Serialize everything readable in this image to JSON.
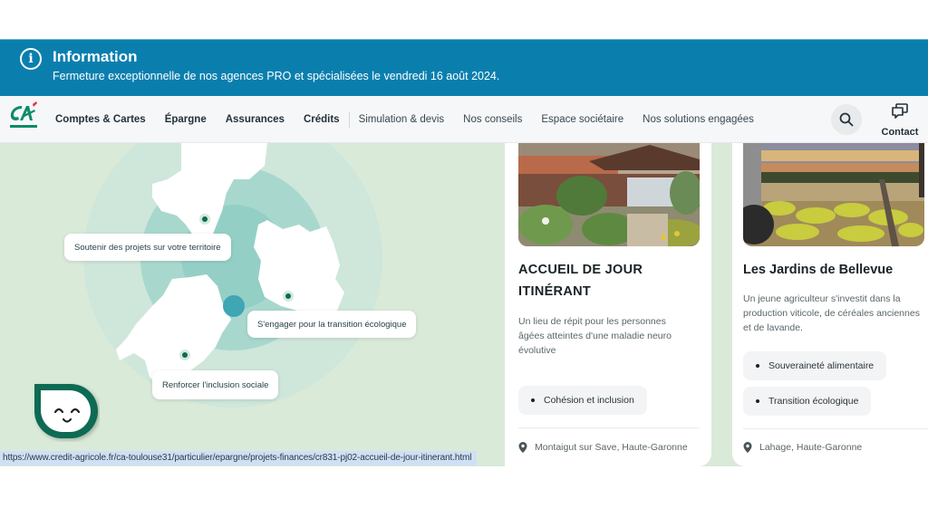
{
  "banner": {
    "icon": "info-circle-icon",
    "title": "Information",
    "message": "Fermeture exceptionnelle de nos agences PRO et spécialisées le vendredi 16 août 2024."
  },
  "nav": {
    "logo_alt": "Crédit Agricole",
    "primary_items": [
      {
        "label": "Comptes & Cartes"
      },
      {
        "label": "Épargne"
      },
      {
        "label": "Assurances"
      },
      {
        "label": "Crédits"
      }
    ],
    "secondary_items": [
      {
        "label": "Simulation & devis"
      },
      {
        "label": "Nos conseils"
      },
      {
        "label": "Espace sociétaire"
      },
      {
        "label": "Nos solutions engagées"
      }
    ],
    "search_icon": "search-icon",
    "contact_label": "Contact",
    "contact_icon": "chat-bubbles-icon"
  },
  "map": {
    "labels": [
      {
        "text": "Soutenir des projets sur votre territoire"
      },
      {
        "text": "S'engager pour la transition écologique"
      },
      {
        "text": "Renforcer l'inclusion sociale"
      }
    ]
  },
  "cards": [
    {
      "title": "ACCUEIL DE JOUR ITINÉRANT",
      "description": "Un lieu de répit pour les personnes âgées atteintes d'une maladie neuro évolutive",
      "tags": [
        "Cohésion et inclusion"
      ],
      "location": "Montaigut sur Save, Haute-Garonne"
    },
    {
      "title": "Les Jardins de Bellevue",
      "description": "Un jeune agriculteur s'investit dans la production viticole, de céréales anciennes et de lavande.",
      "tags": [
        "Souveraineté alimentaire",
        "Transition écologique"
      ],
      "location": "Lahage, Haute-Garonne"
    }
  ],
  "status_bar": {
    "url": "https://www.credit-agricole.fr/ca-toulouse31/particulier/epargne/projets-finances/cr831-pj02-accueil-de-jour-itinerant.html"
  },
  "colors": {
    "banner_bg": "#0a7fae",
    "brand_green": "#0d6a57",
    "map_bg": "#d9ead9",
    "ring_teal": "#8ccbc2",
    "center_dot": "#3fa6b3"
  }
}
